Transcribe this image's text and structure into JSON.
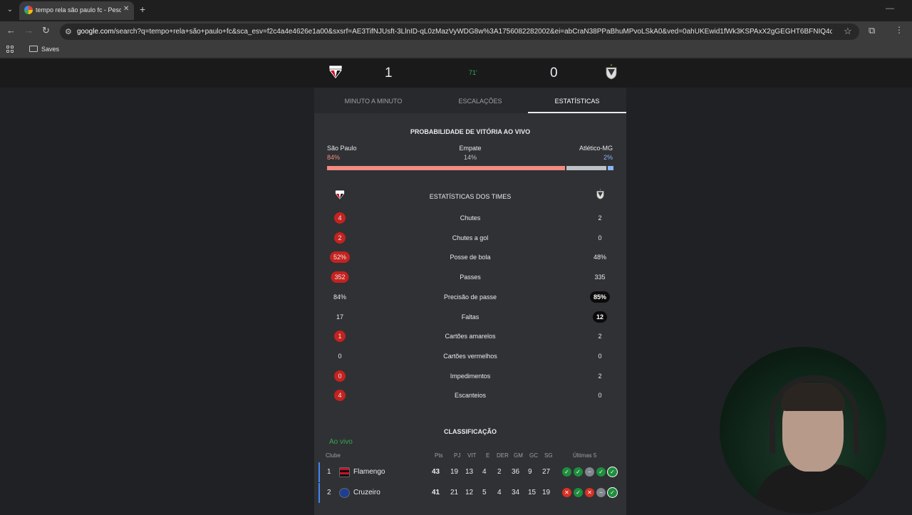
{
  "browser": {
    "tab_title": "tempo rela são paulo fc - Pesqu",
    "url_domain": "google.com",
    "url_rest": "/search?q=tempo+rela+são+paulo+fc&sca_esv=f2c4a4e4626e1a00&sxsrf=AE3TifNJUsft-3LlnID-qL0zMazVyWDG8w%3A1756082282002&ei=abCraN38PPaBhuMPvoLSkA0&ved=0ahUKEwid1fWk3KSPAxX2gGEGHT6BFNIQ4dUDCBA&uact...",
    "bookmark_folder": "Saves"
  },
  "match": {
    "home_score": "1",
    "away_score": "0",
    "minute": "71'",
    "home_crest_text": "SPFC"
  },
  "tabs": [
    "MINUTO A MINUTO",
    "ESCALAÇÕES",
    "ESTATÍSTICAS"
  ],
  "probability": {
    "title": "PROBABILIDADE DE VITÓRIA AO VIVO",
    "home_label": "São Paulo",
    "home_value": "84%",
    "draw_label": "Empate",
    "draw_value": "14%",
    "away_label": "Atlético-MG",
    "away_value": "2%",
    "home_fraction": 0.84,
    "draw_fraction": 0.14,
    "away_fraction": 0.02,
    "colors": {
      "home": "#f28b82",
      "draw": "#bdc1c6",
      "away": "#8ab4f8"
    }
  },
  "team_stats": {
    "title": "ESTATÍSTICAS DOS TIMES",
    "rows": [
      {
        "name": "Chutes",
        "home": "4",
        "away": "2",
        "leader": "home"
      },
      {
        "name": "Chutes a gol",
        "home": "2",
        "away": "0",
        "leader": "home"
      },
      {
        "name": "Posse de bola",
        "home": "52%",
        "away": "48%",
        "leader": "home"
      },
      {
        "name": "Passes",
        "home": "352",
        "away": "335",
        "leader": "home"
      },
      {
        "name": "Precisão de passe",
        "home": "84%",
        "away": "85%",
        "leader": "away"
      },
      {
        "name": "Faltas",
        "home": "17",
        "away": "12",
        "leader": "away"
      },
      {
        "name": "Cartões amarelos",
        "home": "1",
        "away": "2",
        "leader": "home"
      },
      {
        "name": "Cartões vermelhos",
        "home": "0",
        "away": "0",
        "leader": "none"
      },
      {
        "name": "Impedimentos",
        "home": "0",
        "away": "2",
        "leader": "home"
      },
      {
        "name": "Escanteios",
        "home": "4",
        "away": "0",
        "leader": "home"
      }
    ]
  },
  "standings": {
    "title": "CLASSIFICAÇÃO",
    "live_label": "Ao vivo",
    "headers": [
      "Clube",
      "Pts",
      "PJ",
      "VIT",
      "E",
      "DER",
      "GM",
      "GC",
      "SG",
      "Últimas 5"
    ],
    "rows": [
      {
        "pos": "1",
        "club": "Flamengo",
        "pts": "43",
        "pj": "19",
        "vit": "13",
        "e": "4",
        "der": "2",
        "gm": "36",
        "gc": "9",
        "sg": "27",
        "form": [
          "w",
          "w",
          "d",
          "w",
          "w"
        ]
      },
      {
        "pos": "2",
        "club": "Cruzeiro",
        "pts": "41",
        "pj": "21",
        "vit": "12",
        "e": "5",
        "der": "4",
        "gm": "34",
        "gc": "15",
        "sg": "19",
        "form": [
          "l",
          "w",
          "l",
          "d",
          "w"
        ]
      }
    ]
  }
}
